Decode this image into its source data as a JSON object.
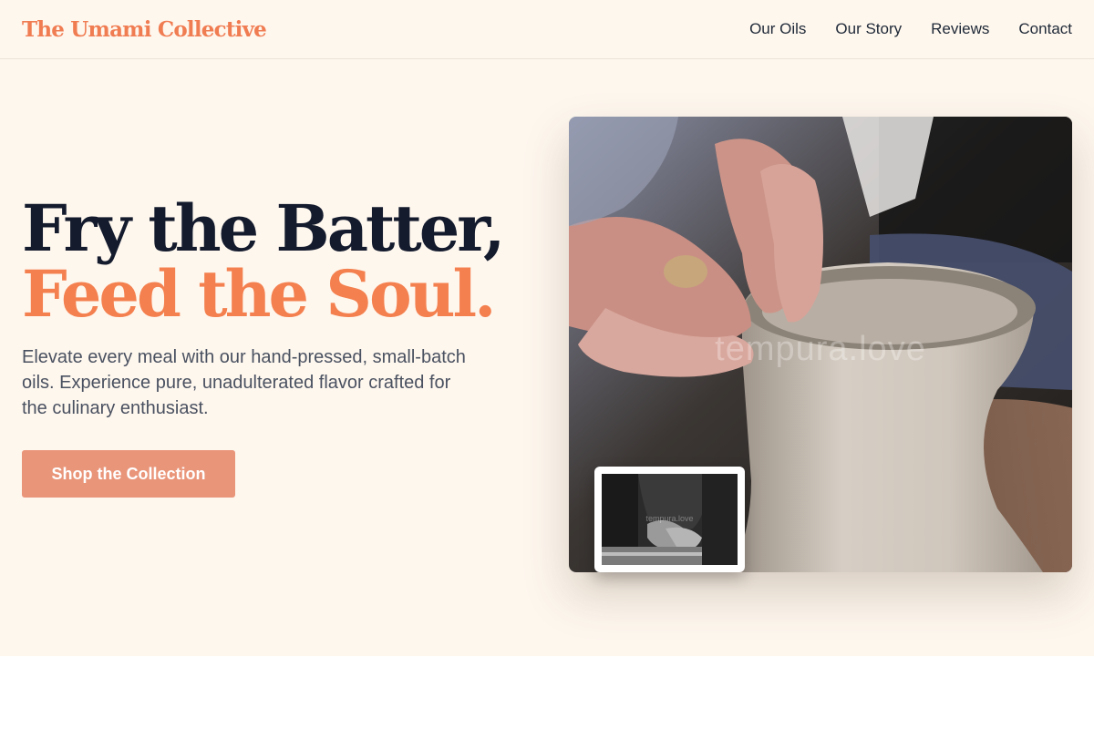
{
  "brand": {
    "name": "The Umami Collective",
    "color": "#f07c52"
  },
  "nav": {
    "items": [
      {
        "label": "Our Oils"
      },
      {
        "label": "Our Story"
      },
      {
        "label": "Reviews"
      },
      {
        "label": "Contact"
      }
    ]
  },
  "hero": {
    "headline_line1": "Fry the Batter,",
    "headline_line2": "Feed the Soul.",
    "subtext": "Elevate every meal with our hand-pressed, small-batch oils. Experience pure, unadulterated flavor crafted for the culinary enthusiast.",
    "cta_label": "Shop the Collection",
    "accent_color": "#f4804f",
    "cta_color": "#e9957a",
    "background": "#fef7ee"
  },
  "media": {
    "main_image_watermark": "tempura.love",
    "thumbnail_watermark": "tempura.love"
  }
}
